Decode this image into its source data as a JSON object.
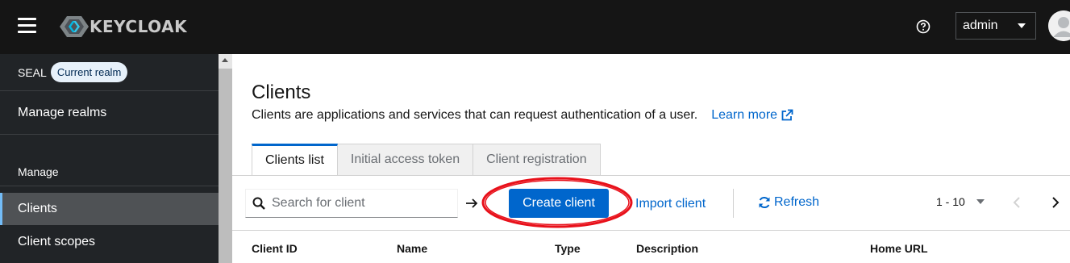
{
  "header": {
    "brand": "KEYCLOAK",
    "user": "admin"
  },
  "sidebar": {
    "realm": {
      "name": "SEAL",
      "badge": "Current realm"
    },
    "manage_realms": "Manage realms",
    "section_title": "Manage",
    "items": [
      {
        "label": "Clients",
        "active": true
      },
      {
        "label": "Client scopes",
        "active": false
      }
    ]
  },
  "main": {
    "title": "Clients",
    "description": "Clients are applications and services that can request authentication of a user.",
    "learn_more": "Learn more",
    "tabs": [
      {
        "label": "Clients list",
        "active": true
      },
      {
        "label": "Initial access token",
        "active": false
      },
      {
        "label": "Client registration",
        "active": false
      }
    ],
    "toolbar": {
      "search_placeholder": "Search for client",
      "create_label": "Create client",
      "import_label": "Import client",
      "refresh_label": "Refresh",
      "pagination": "1 - 10"
    },
    "table": {
      "columns": [
        "Client ID",
        "Name",
        "Type",
        "Description",
        "Home URL"
      ]
    }
  },
  "colors": {
    "primary": "#0066cc",
    "masthead": "#151515",
    "sidebar": "#212427",
    "annotation": "#e8101a"
  }
}
